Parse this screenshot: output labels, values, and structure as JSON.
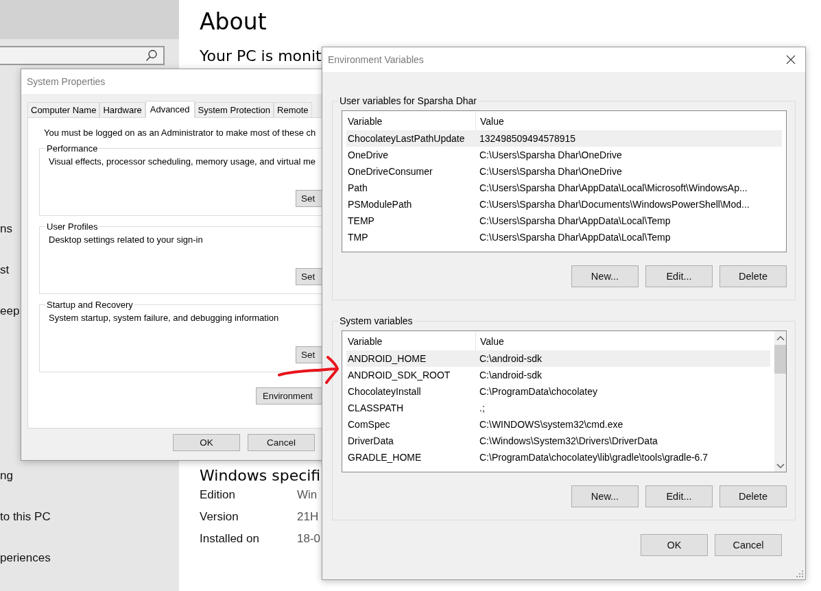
{
  "settings": {
    "sidebar": {
      "items": [
        {
          "label": "ns"
        },
        {
          "label": "st"
        },
        {
          "label": "eep"
        },
        {
          "label": "ng"
        },
        {
          "label": "to this PC"
        },
        {
          "label": "periences"
        }
      ]
    },
    "title": "About",
    "subtitle": "Your PC is monit",
    "section_title": "Windows specifi",
    "specs": [
      {
        "label": "Edition",
        "value": "Win"
      },
      {
        "label": "Version",
        "value": "21H"
      },
      {
        "label": "Installed on",
        "value": "18-0"
      }
    ]
  },
  "system_properties": {
    "title": "System Properties",
    "tabs": [
      {
        "label": "Computer Name",
        "selected": false
      },
      {
        "label": "Hardware",
        "selected": false
      },
      {
        "label": "Advanced",
        "selected": true
      },
      {
        "label": "System Protection",
        "selected": false
      },
      {
        "label": "Remote",
        "selected": false
      }
    ],
    "notice": "You must be logged on as an Administrator to make most of these ch",
    "groups": [
      {
        "title": "Performance",
        "text": "Visual effects, processor scheduling, memory usage, and virtual me",
        "button": "Set"
      },
      {
        "title": "User Profiles",
        "text": "Desktop settings related to your sign-in",
        "button": "Set"
      },
      {
        "title": "Startup and Recovery",
        "text": "System startup, system failure, and debugging information",
        "button": "Set"
      }
    ],
    "env_button": "Environment",
    "buttons": [
      "OK",
      "Cancel"
    ]
  },
  "environment_variables": {
    "title": "Environment Variables",
    "user": {
      "title": "User variables for Sparsha Dhar",
      "columns": [
        "Variable",
        "Value"
      ],
      "rows": [
        {
          "name": "ChocolateyLastPathUpdate",
          "value": "132498509494578915",
          "selected": true
        },
        {
          "name": "OneDrive",
          "value": "C:\\Users\\Sparsha Dhar\\OneDrive",
          "selected": false
        },
        {
          "name": "OneDriveConsumer",
          "value": "C:\\Users\\Sparsha Dhar\\OneDrive",
          "selected": false
        },
        {
          "name": "Path",
          "value": "C:\\Users\\Sparsha Dhar\\AppData\\Local\\Microsoft\\WindowsAp...",
          "selected": false
        },
        {
          "name": "PSModulePath",
          "value": "C:\\Users\\Sparsha Dhar\\Documents\\WindowsPowerShell\\Mod...",
          "selected": false
        },
        {
          "name": "TEMP",
          "value": "C:\\Users\\Sparsha Dhar\\AppData\\Local\\Temp",
          "selected": false
        },
        {
          "name": "TMP",
          "value": "C:\\Users\\Sparsha Dhar\\AppData\\Local\\Temp",
          "selected": false
        }
      ],
      "buttons": [
        "New...",
        "Edit...",
        "Delete"
      ]
    },
    "system": {
      "title": "System variables",
      "columns": [
        "Variable",
        "Value"
      ],
      "rows": [
        {
          "name": "ANDROID_HOME",
          "value": "C:\\android-sdk",
          "selected": true
        },
        {
          "name": "ANDROID_SDK_ROOT",
          "value": "C:\\android-sdk",
          "selected": false
        },
        {
          "name": "ChocolateyInstall",
          "value": "C:\\ProgramData\\chocolatey",
          "selected": false
        },
        {
          "name": "CLASSPATH",
          "value": ".;",
          "selected": false
        },
        {
          "name": "ComSpec",
          "value": "C:\\WINDOWS\\system32\\cmd.exe",
          "selected": false
        },
        {
          "name": "DriverData",
          "value": "C:\\Windows\\System32\\Drivers\\DriverData",
          "selected": false
        },
        {
          "name": "GRADLE_HOME",
          "value": "C:\\ProgramData\\chocolatey\\lib\\gradle\\tools\\gradle-6.7",
          "selected": false
        }
      ],
      "buttons": [
        "New...",
        "Edit...",
        "Delete"
      ]
    },
    "buttons": [
      "OK",
      "Cancel"
    ]
  }
}
